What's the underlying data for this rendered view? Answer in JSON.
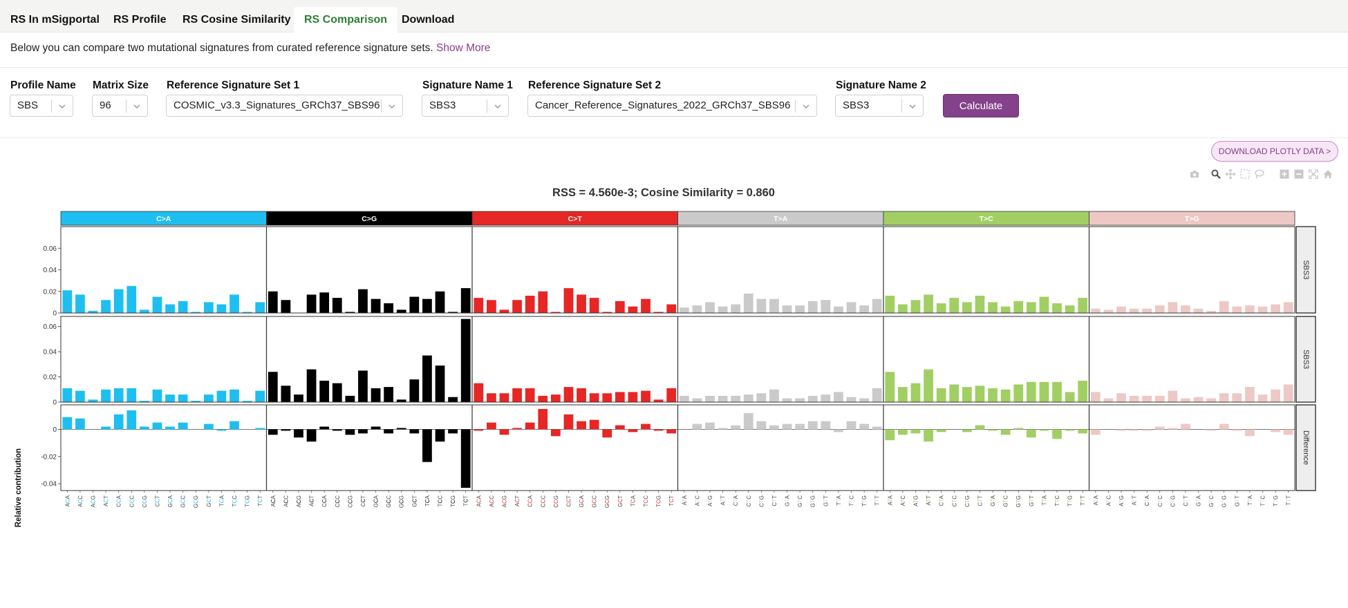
{
  "tabs": [
    {
      "label": "RS In mSigportal",
      "active": false
    },
    {
      "label": "RS Profile",
      "active": false
    },
    {
      "label": "RS Cosine Similarity",
      "active": false
    },
    {
      "label": "RS Comparison",
      "active": true
    },
    {
      "label": "Download",
      "active": false
    }
  ],
  "description": {
    "text": "Below you can compare two mutational signatures from curated reference signature sets.",
    "show_more": "Show More"
  },
  "form": {
    "profile_name": {
      "label": "Profile Name",
      "value": "SBS"
    },
    "matrix_size": {
      "label": "Matrix Size",
      "value": "96"
    },
    "ref_set_1": {
      "label": "Reference Signature Set 1",
      "value": "COSMIC_v3.3_Signatures_GRCh37_SBS96"
    },
    "sig_name_1": {
      "label": "Signature Name 1",
      "value": "SBS3"
    },
    "ref_set_2": {
      "label": "Reference Signature Set 2",
      "value": "Cancer_Reference_Signatures_2022_GRCh37_SBS96"
    },
    "sig_name_2": {
      "label": "Signature Name 2",
      "value": "SBS3"
    },
    "calculate_label": "Calculate"
  },
  "download_label": "DOWNLOAD PLOTLY DATA >",
  "modebar_icons": [
    "camera-icon",
    "zoom-icon",
    "pan-icon",
    "box-select-icon",
    "lasso-icon",
    "zoom-in-icon",
    "zoom-out-icon",
    "autoscale-icon",
    "reset-axes-icon"
  ],
  "chart_data": {
    "type": "bar",
    "title": "RSS = 4.560e-3; Cosine Similarity = 0.860",
    "ylabel": "Relative contribution",
    "groups": [
      {
        "name": "C>A",
        "color": "#1ebff0",
        "header_text_color": "#ffffff"
      },
      {
        "name": "C>G",
        "color": "#000000",
        "header_text_color": "#ffffff"
      },
      {
        "name": "C>T",
        "color": "#e62725",
        "header_text_color": "#ffffff"
      },
      {
        "name": "T>A",
        "color": "#cbcacb",
        "header_text_color": "#ffffff"
      },
      {
        "name": "T>C",
        "color": "#a1cf64",
        "header_text_color": "#ffffff"
      },
      {
        "name": "T>G",
        "color": "#edc8c5",
        "header_text_color": "#ffffff"
      }
    ],
    "contexts": {
      "C": [
        "ACA",
        "ACC",
        "ACG",
        "ACT",
        "CCA",
        "CCC",
        "CCG",
        "CCT",
        "GCA",
        "GCC",
        "GCG",
        "GCT",
        "TCA",
        "TCC",
        "TCG",
        "TCT"
      ],
      "T": [
        "ATA",
        "ATC",
        "ATG",
        "ATT",
        "CTA",
        "CTC",
        "CTG",
        "CTT",
        "GTA",
        "GTC",
        "GTG",
        "GTT",
        "TTA",
        "TTC",
        "TTG",
        "TTT"
      ]
    },
    "panels": [
      {
        "label": "SBS3",
        "ylim": [
          0,
          0.08
        ],
        "yticks": [
          0,
          0.02,
          0.04,
          0.06
        ],
        "ytick_labels": [
          "0",
          "0.02",
          "0.04",
          "0.06"
        ],
        "values": [
          0.021,
          0.017,
          0.002,
          0.012,
          0.022,
          0.025,
          0.003,
          0.015,
          0.008,
          0.011,
          0.001,
          0.01,
          0.008,
          0.017,
          0.001,
          0.01,
          0.02,
          0.012,
          0.0,
          0.017,
          0.019,
          0.014,
          0.001,
          0.022,
          0.013,
          0.009,
          0.003,
          0.015,
          0.013,
          0.02,
          0.001,
          0.023,
          0.014,
          0.012,
          0.003,
          0.012,
          0.016,
          0.02,
          0.001,
          0.023,
          0.017,
          0.014,
          0.001,
          0.011,
          0.006,
          0.013,
          0.001,
          0.008,
          0.005,
          0.007,
          0.01,
          0.006,
          0.008,
          0.018,
          0.013,
          0.013,
          0.007,
          0.007,
          0.011,
          0.012,
          0.006,
          0.01,
          0.007,
          0.013,
          0.016,
          0.008,
          0.012,
          0.017,
          0.009,
          0.014,
          0.01,
          0.016,
          0.01,
          0.006,
          0.011,
          0.01,
          0.015,
          0.009,
          0.007,
          0.014,
          0.004,
          0.003,
          0.006,
          0.004,
          0.004,
          0.007,
          0.01,
          0.007,
          0.004,
          0.002,
          0.011,
          0.006,
          0.007,
          0.006,
          0.008,
          0.01
        ]
      },
      {
        "label": "SBS3",
        "ylim": [
          0,
          0.068
        ],
        "yticks": [
          0,
          0.02,
          0.04,
          0.06
        ],
        "ytick_labels": [
          "0",
          "0.02",
          "0.04",
          "0.06"
        ],
        "values": [
          0.011,
          0.009,
          0.002,
          0.01,
          0.011,
          0.011,
          0.001,
          0.01,
          0.006,
          0.006,
          0.001,
          0.006,
          0.009,
          0.01,
          0.001,
          0.009,
          0.024,
          0.013,
          0.006,
          0.026,
          0.017,
          0.015,
          0.005,
          0.025,
          0.011,
          0.012,
          0.002,
          0.018,
          0.037,
          0.029,
          0.004,
          0.066,
          0.015,
          0.007,
          0.007,
          0.011,
          0.011,
          0.005,
          0.006,
          0.012,
          0.011,
          0.007,
          0.007,
          0.008,
          0.008,
          0.009,
          0.002,
          0.011,
          0.005,
          0.003,
          0.005,
          0.005,
          0.005,
          0.006,
          0.007,
          0.01,
          0.003,
          0.003,
          0.005,
          0.006,
          0.008,
          0.004,
          0.003,
          0.011,
          0.024,
          0.012,
          0.015,
          0.026,
          0.011,
          0.014,
          0.012,
          0.013,
          0.011,
          0.01,
          0.014,
          0.016,
          0.016,
          0.016,
          0.008,
          0.017,
          0.008,
          0.003,
          0.007,
          0.005,
          0.005,
          0.005,
          0.009,
          0.003,
          0.004,
          0.003,
          0.007,
          0.007,
          0.012,
          0.006,
          0.01,
          0.014
        ]
      },
      {
        "label": "Difference",
        "ylim": [
          -0.045,
          0.018
        ],
        "yticks": [
          -0.04,
          -0.02,
          0
        ],
        "ytick_labels": [
          "-0.04",
          "-0.02",
          "0"
        ],
        "values": [
          0.009,
          0.008,
          0.0,
          0.002,
          0.011,
          0.014,
          0.002,
          0.005,
          0.002,
          0.005,
          0.0,
          0.004,
          -0.001,
          0.006,
          0.0,
          0.001,
          -0.004,
          -0.001,
          -0.006,
          -0.009,
          0.002,
          -0.001,
          -0.004,
          -0.003,
          0.002,
          -0.003,
          0.001,
          -0.003,
          -0.024,
          -0.009,
          -0.003,
          -0.043,
          -0.001,
          0.005,
          -0.004,
          0.001,
          0.005,
          0.015,
          -0.005,
          0.011,
          0.006,
          0.007,
          -0.006,
          0.003,
          -0.002,
          0.004,
          -0.001,
          -0.003,
          0.0,
          0.004,
          0.005,
          0.001,
          0.003,
          0.012,
          0.006,
          0.003,
          0.004,
          0.004,
          0.006,
          0.006,
          -0.002,
          0.006,
          0.004,
          0.002,
          -0.008,
          -0.004,
          -0.003,
          -0.009,
          -0.002,
          0.0,
          -0.002,
          0.003,
          -0.001,
          -0.004,
          0.001,
          -0.006,
          -0.001,
          -0.007,
          -0.001,
          -0.003,
          -0.004,
          0.0,
          -0.001,
          -0.001,
          -0.001,
          0.002,
          0.001,
          0.004,
          0.0,
          -0.001,
          0.004,
          -0.001,
          -0.005,
          0.0,
          -0.002,
          -0.004
        ]
      }
    ]
  }
}
